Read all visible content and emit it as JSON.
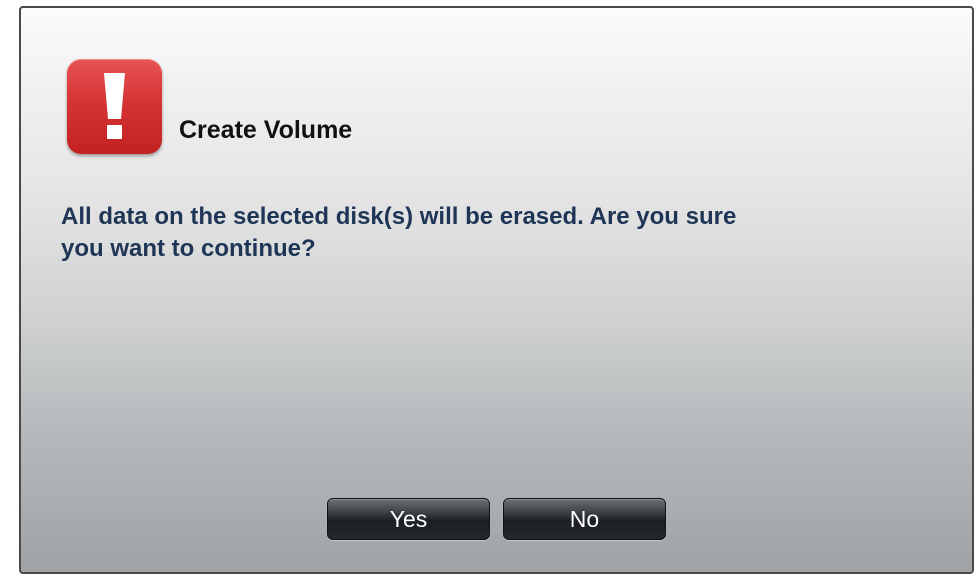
{
  "dialog": {
    "title": "Create Volume",
    "icon": "warning-exclamation-icon",
    "message_line1": "All data on the selected disk(s) will be erased. Are you sure",
    "message_line2": "you want to continue?",
    "yes_label": "Yes",
    "no_label": "No"
  },
  "colors": {
    "icon_red": "#d63434",
    "message_text": "#1f3556",
    "button_dark": "#1c1f22"
  }
}
